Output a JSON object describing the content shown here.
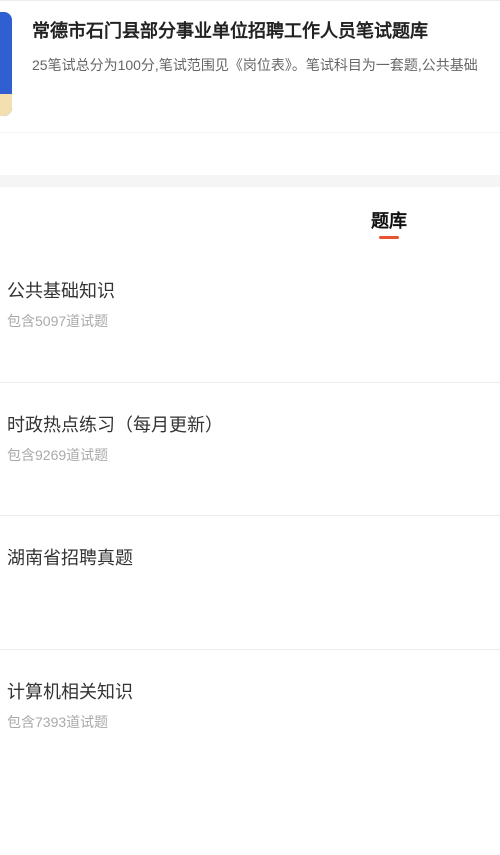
{
  "header": {
    "title": "常德市石门县部分事业单位招聘工作人员笔试题库",
    "description": "25笔试总分为100分,笔试范围见《岗位表》。笔试科目为一套题,公共基础"
  },
  "tabs": [
    {
      "label": "题库",
      "active": true
    }
  ],
  "question_banks": [
    {
      "name": "公共基础知识",
      "count": "包含5097道试题"
    },
    {
      "name": "时政热点练习（每月更新）",
      "count": "包含9269道试题"
    },
    {
      "name": "湖南省招聘真题",
      "count": ""
    },
    {
      "name": "计算机相关知识",
      "count": "包含7393道试题"
    }
  ],
  "colors": {
    "accent": "#e8542e",
    "cover": "#2f5fd1"
  }
}
